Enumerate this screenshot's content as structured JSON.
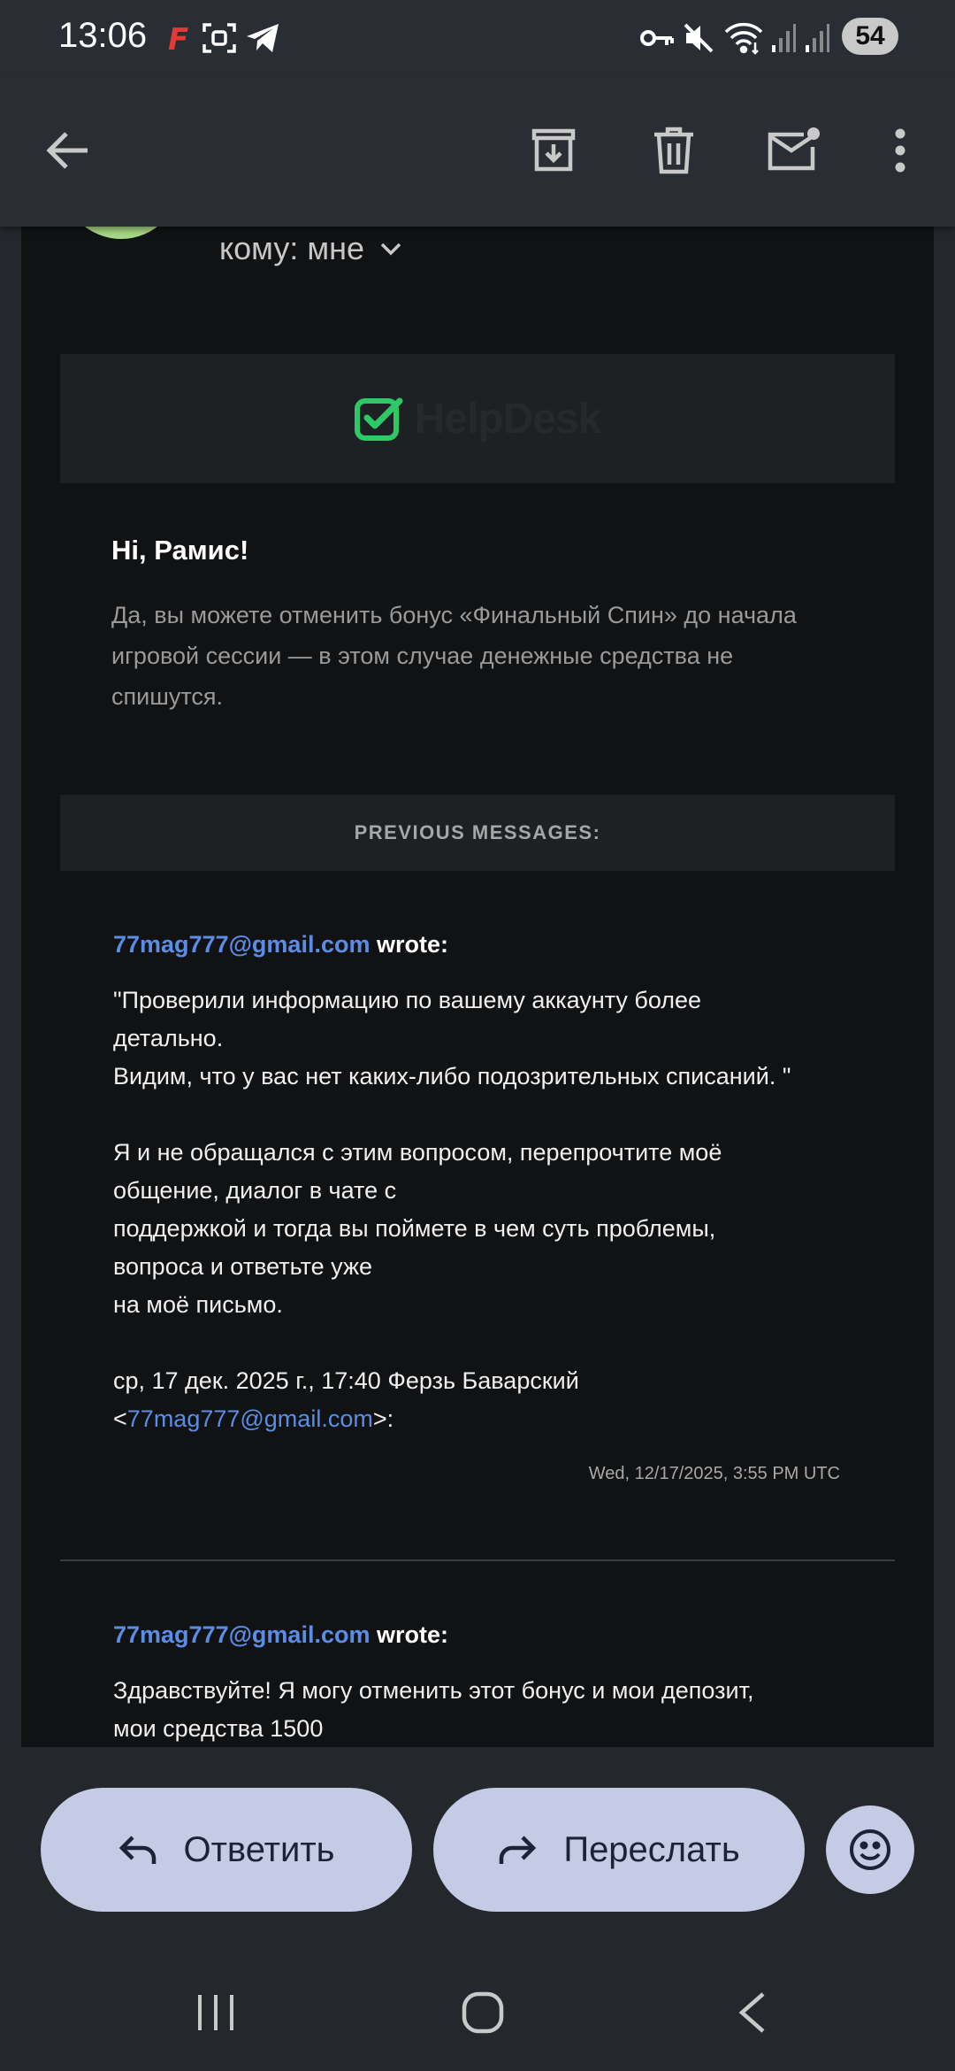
{
  "status_bar": {
    "time": "13:06",
    "battery": "54",
    "icons_left": [
      "flipboard-icon",
      "screenshot-icon",
      "telegram-icon"
    ],
    "icons_right": [
      "key-icon",
      "mute-icon",
      "wifi-icon",
      "signal-icon",
      "signal-icon"
    ]
  },
  "toolbar": {
    "icons": [
      "back-arrow-icon",
      "archive-icon",
      "delete-icon",
      "mark-unread-icon",
      "more-vert-icon"
    ]
  },
  "email": {
    "recipient_text": "кому: мне",
    "logo_text": "HelpDesk",
    "greeting": "Hi, Рамис!",
    "intro_lines": [
      "Да, вы можете отменить бонус «Финальный Спин» до начала",
      "игровой сессии — в этом случае денежные средства не",
      "спишутся."
    ],
    "previous_label": "PREVIOUS MESSAGES:",
    "messages": [
      {
        "sender": "77mag777@gmail.com",
        "wrote": " wrote:",
        "body": [
          "\"Проверили информацию по вашему аккаунту более",
          "детально.",
          "Видим, что у вас нет каких-либо подозрительных списаний. \"",
          "",
          "Я и не обращался с этим вопросом, перепрочтите моё",
          "общение, диалог в чате с",
          "поддержкой и тогда вы поймете в чем суть проблемы,",
          "вопроса и ответьте уже",
          "на моё письмо.",
          "",
          "ср, 17 дек. 2025 г., 17:40 Ферзь Баварский"
        ],
        "quote_open": "<",
        "quote_email": "77mag777@gmail.com",
        "quote_close": ">:",
        "date": "Wed, 12/17/2025, 3:55 PM UTC"
      },
      {
        "sender": "77mag777@gmail.com",
        "wrote": " wrote:",
        "body": [
          "Здравствуйте! Я могу отменить этот бонус и мои депозит,",
          "мои средства 1500"
        ]
      }
    ]
  },
  "actions": {
    "reply_label": "Ответить",
    "forward_label": "Переслать"
  },
  "colors": {
    "accent_link": "#5a8de6",
    "button_bg": "#c5cae5",
    "avatar": "#a7d685",
    "logo_green": "#2ec866",
    "background": "#111214"
  }
}
